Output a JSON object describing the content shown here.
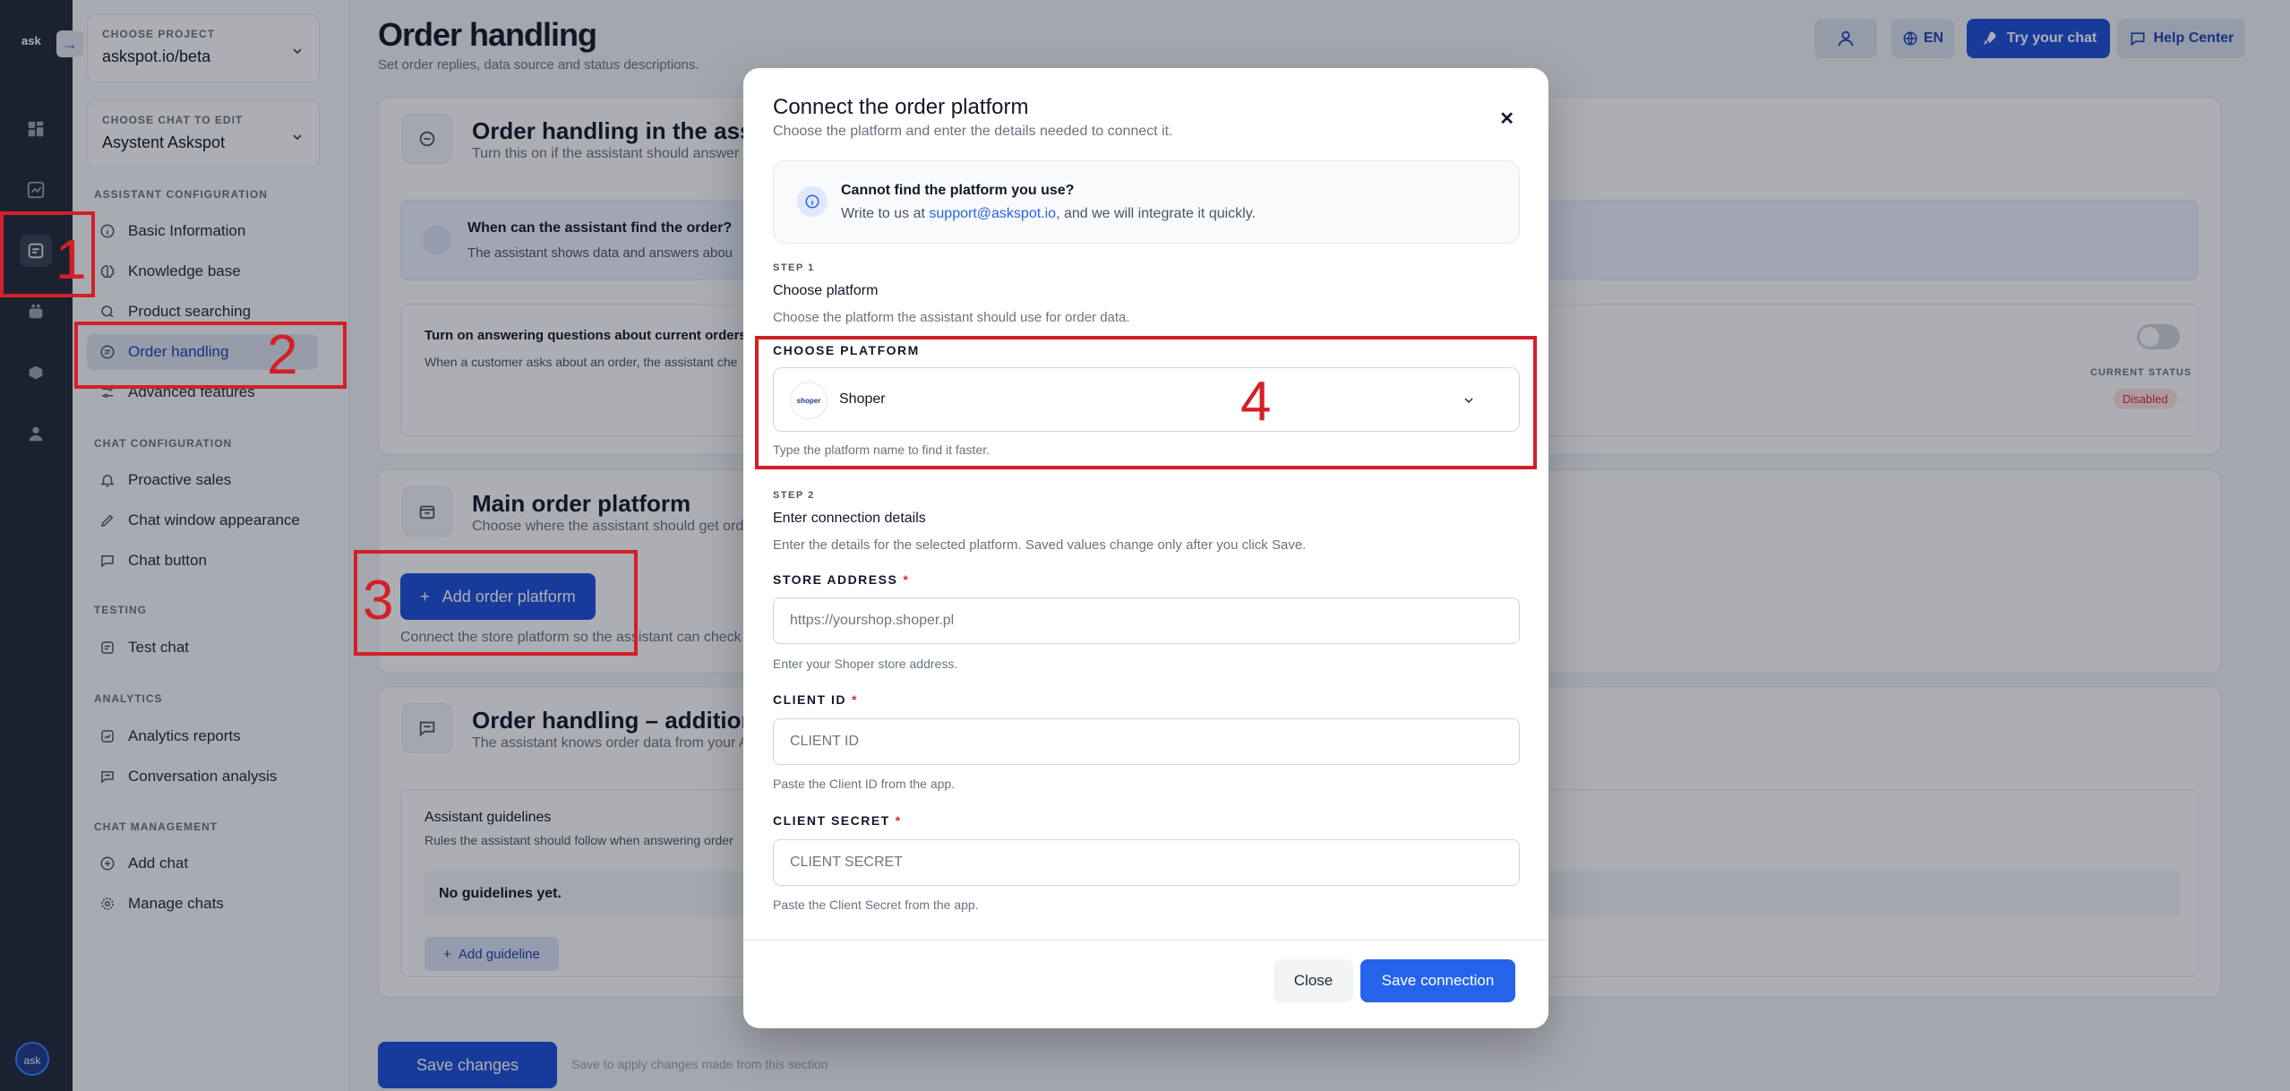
{
  "rail": {
    "logo": "ask",
    "avatar": "ask",
    "collapse_icon": "arrow-right-icon"
  },
  "sidebar": {
    "project": {
      "label": "CHOOSE PROJECT",
      "value": "askspot.io/beta"
    },
    "chat": {
      "label": "CHOOSE CHAT TO EDIT",
      "value": "Asystent Askspot"
    },
    "sections": {
      "assistant": "ASSISTANT CONFIGURATION",
      "chat": "CHAT CONFIGURATION",
      "testing": "TESTING",
      "analytics": "ANALYTICS",
      "management": "CHAT MANAGEMENT"
    },
    "items": [
      {
        "label": "Basic Information"
      },
      {
        "label": "Knowledge base"
      },
      {
        "label": "Product searching"
      },
      {
        "label": "Order handling"
      },
      {
        "label": "Advanced features"
      },
      {
        "label": "Proactive sales"
      },
      {
        "label": "Chat window appearance"
      },
      {
        "label": "Chat button"
      },
      {
        "label": "Test chat"
      },
      {
        "label": "Analytics reports"
      },
      {
        "label": "Conversation analysis"
      },
      {
        "label": "Add chat"
      },
      {
        "label": "Manage chats"
      }
    ]
  },
  "header": {
    "title": "Order handling",
    "subtitle": "Set order replies, data source and status descriptions.",
    "lang": "EN",
    "try_chat": "Try your chat",
    "help": "Help Center"
  },
  "cards": {
    "assistant": {
      "title": "Order handling in the assistant",
      "subtitle": "Turn this on if the assistant should answer q",
      "info_title": "When can the assistant find the order?",
      "info_text": "The assistant shows data and answers abou",
      "toggle_title": "Turn on answering questions about current orders",
      "toggle_text": "When a customer asks about an order, the assistant che",
      "status_label": "CURRENT STATUS",
      "status_value": "Disabled"
    },
    "platform": {
      "title": "Main order platform",
      "subtitle": "Choose where the assistant should get orde",
      "add_button": "Add order platform",
      "hint": "Connect the store platform so the assistant can check o"
    },
    "additional": {
      "title": "Order handling – additional in",
      "subtitle": "The assistant knows order data from your A",
      "guidelines_title": "Assistant guidelines",
      "guidelines_text": "Rules the assistant should follow when answering order",
      "empty": "No guidelines yet.",
      "add_guideline": "Add guideline"
    }
  },
  "footer": {
    "save": "Save changes",
    "note": "Save to apply changes made from this section"
  },
  "modal": {
    "title": "Connect the order platform",
    "subtitle": "Choose the platform and enter the details needed to connect it.",
    "info": {
      "title": "Cannot find the platform you use?",
      "text_before": "Write to us at ",
      "email": "support@askspot.io",
      "text_after": ", and we will integrate it quickly."
    },
    "step1": {
      "label": "STEP 1",
      "title": "Choose platform",
      "desc": "Choose the platform the assistant should use for order data.",
      "field_label": "CHOOSE PLATFORM",
      "selected": "Shoper",
      "logo_text": "shoper",
      "hint": "Type the platform name to find it faster."
    },
    "step2": {
      "label": "STEP 2",
      "title": "Enter connection details",
      "desc": "Enter the details for the selected platform. Saved values change only after you click Save.",
      "store": {
        "label": "STORE ADDRESS",
        "required": "*",
        "placeholder": "https://yourshop.shoper.pl",
        "hint": "Enter your Shoper store address."
      },
      "client_id": {
        "label": "CLIENT ID",
        "required": "*",
        "placeholder": "CLIENT ID",
        "hint": "Paste the Client ID from the app."
      },
      "client_secret": {
        "label": "CLIENT SECRET",
        "required": "*",
        "placeholder": "CLIENT SECRET",
        "hint": "Paste the Client Secret from the app."
      }
    },
    "buttons": {
      "close": "Close",
      "save": "Save connection"
    }
  },
  "annotations": [
    "1",
    "2",
    "3",
    "4"
  ]
}
